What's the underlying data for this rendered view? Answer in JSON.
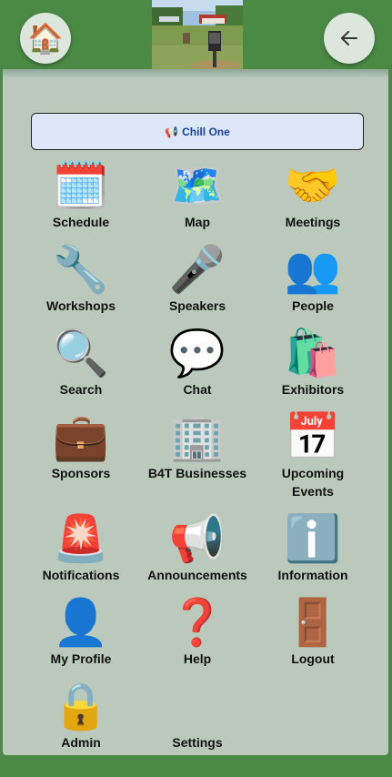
{
  "header": {
    "home_icon": "home-icon",
    "back_icon": "arrow-left-icon"
  },
  "announcement": {
    "icon": "📢",
    "text": "Chill One"
  },
  "tiles": [
    {
      "label": "Schedule",
      "icon": "🗓️"
    },
    {
      "label": "Map",
      "icon": "🗺️"
    },
    {
      "label": "Meetings",
      "icon": "🤝"
    },
    {
      "label": "Workshops",
      "icon": "🔧"
    },
    {
      "label": "Speakers",
      "icon": "🎤"
    },
    {
      "label": "People",
      "icon": "👥"
    },
    {
      "label": "Search",
      "icon": "🔍"
    },
    {
      "label": "Chat",
      "icon": "💬"
    },
    {
      "label": "Exhibitors",
      "icon": "🛍️"
    },
    {
      "label": "Sponsors",
      "icon": "💼"
    },
    {
      "label": "B4T Businesses",
      "icon": "🏢"
    },
    {
      "label": "Upcoming Events",
      "icon": "📅"
    },
    {
      "label": "Notifications",
      "icon": "🚨"
    },
    {
      "label": "Announcements",
      "icon": "📢"
    },
    {
      "label": "Information",
      "icon": "ℹ️"
    },
    {
      "label": "My Profile",
      "icon": "👤"
    },
    {
      "label": "Help",
      "icon": "❓"
    },
    {
      "label": "Logout",
      "icon": "🚪"
    },
    {
      "label": "Admin",
      "icon": "🔒"
    },
    {
      "label": "Settings",
      "icon": ""
    }
  ]
}
